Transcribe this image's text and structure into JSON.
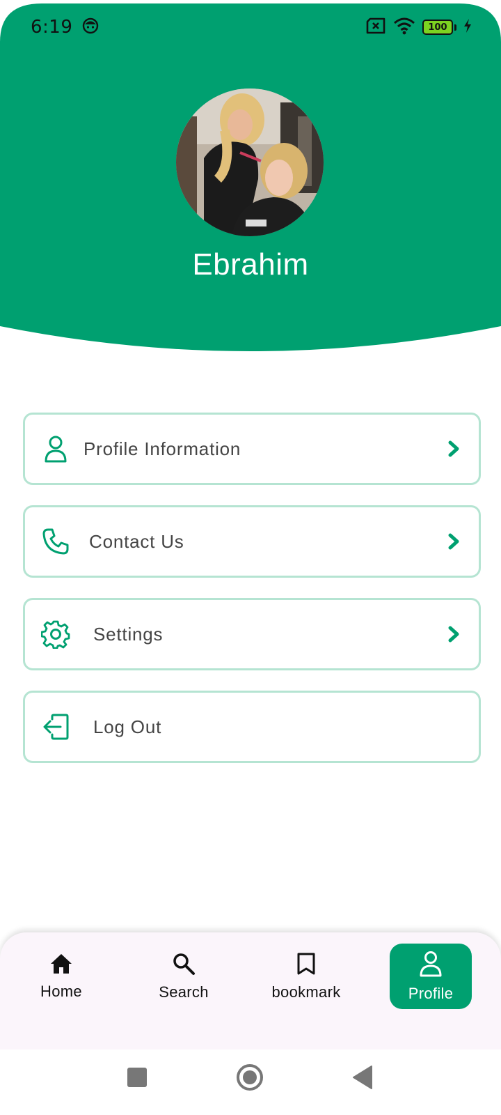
{
  "status_bar": {
    "time": "6:19",
    "battery_level": "100"
  },
  "profile": {
    "name": "Ebrahim",
    "avatar_description": "photo"
  },
  "menu": {
    "items": [
      {
        "label": "Profile Information",
        "icon": "person-icon",
        "has_chevron": true
      },
      {
        "label": "Contact Us",
        "icon": "phone-icon",
        "has_chevron": true
      },
      {
        "label": "Settings",
        "icon": "gear-icon",
        "has_chevron": true
      },
      {
        "label": "Log Out",
        "icon": "logout-icon",
        "has_chevron": false
      }
    ]
  },
  "bottom_nav": {
    "items": [
      {
        "label": "Home",
        "icon": "home-icon",
        "active": false
      },
      {
        "label": "Search",
        "icon": "search-icon",
        "active": false
      },
      {
        "label": "bookmark",
        "icon": "bookmark-icon",
        "active": false
      },
      {
        "label": "Profile",
        "icon": "person-icon",
        "active": true
      }
    ]
  },
  "colors": {
    "primary": "#00A070",
    "border": "#B5E4D2",
    "nav_bg": "#FBF5FB",
    "battery": "#7CD321"
  }
}
